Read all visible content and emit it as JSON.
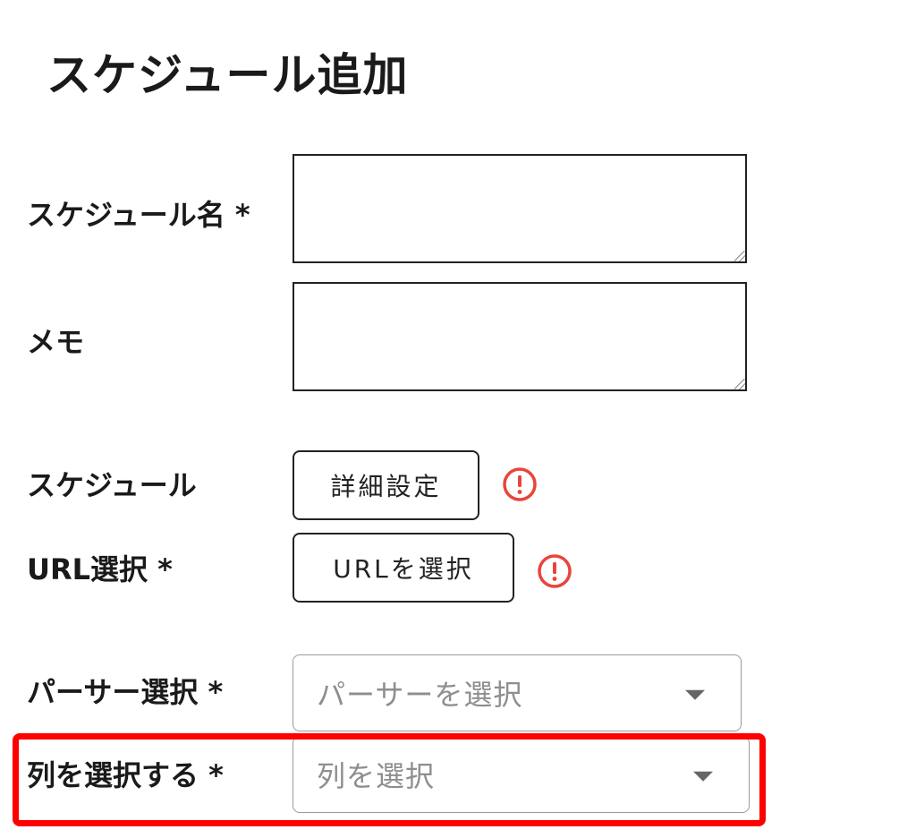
{
  "page": {
    "title": "スケジュール追加"
  },
  "form": {
    "schedule_name": {
      "label": "スケジュール名 *",
      "value": ""
    },
    "memo": {
      "label": "メモ",
      "value": ""
    },
    "schedule": {
      "label": "スケジュール",
      "button_label": "詳細設定",
      "alert_icon": "exclamation-circle-icon"
    },
    "url": {
      "label": "URL選択 *",
      "button_label": "URLを選択",
      "alert_icon": "exclamation-circle-icon"
    },
    "parser": {
      "label": "パーサー選択 *",
      "selected": "",
      "placeholder": "パーサーを選択",
      "caret_icon": "caret-down-icon"
    },
    "column": {
      "label": "列を選択する *",
      "selected": "",
      "placeholder": "列を選択",
      "caret_icon": "caret-down-icon"
    }
  },
  "colors": {
    "alert": "#e8453c",
    "highlight": "#ff0000",
    "border": "#222222",
    "placeholder": "#8e8e8e"
  }
}
